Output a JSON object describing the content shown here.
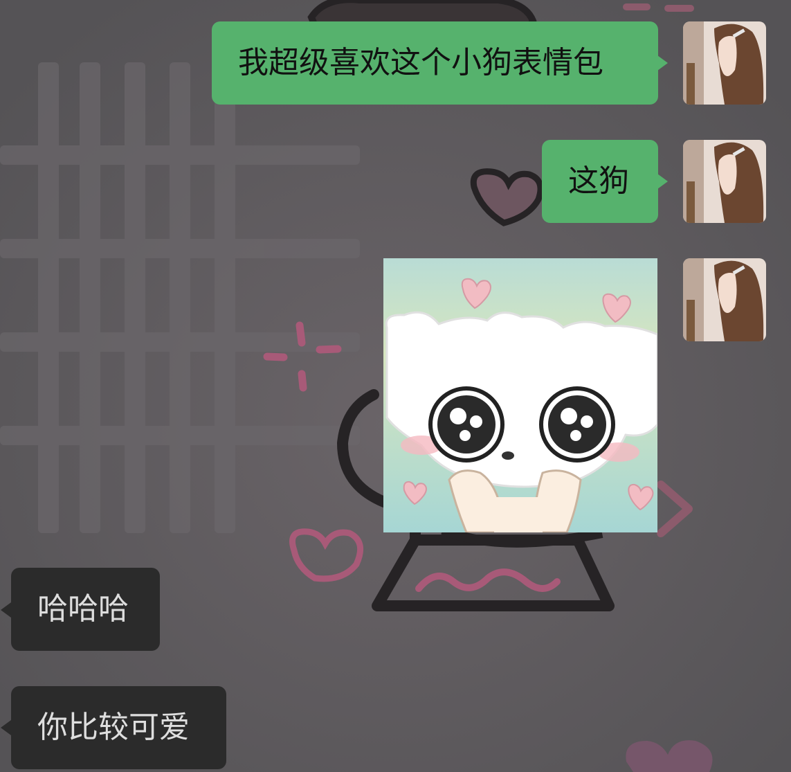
{
  "messages": [
    {
      "side": "right",
      "type": "text",
      "text": "我超级喜欢这个小狗表情包"
    },
    {
      "side": "right",
      "type": "text",
      "text": "这狗"
    },
    {
      "side": "right",
      "type": "sticker",
      "icon": "crying-white-puppy-with-hearts-sticker"
    },
    {
      "side": "left",
      "type": "text",
      "text": "哈哈哈"
    },
    {
      "side": "left",
      "type": "text",
      "text": "你比较可爱"
    }
  ],
  "avatar": {
    "icon": "girl-with-long-brown-hair-avatar"
  },
  "colors": {
    "background": "#5f5c5f",
    "my_bubble": "#56b26d",
    "their_bubble": "#2b2b2b",
    "their_text": "#dedede"
  }
}
